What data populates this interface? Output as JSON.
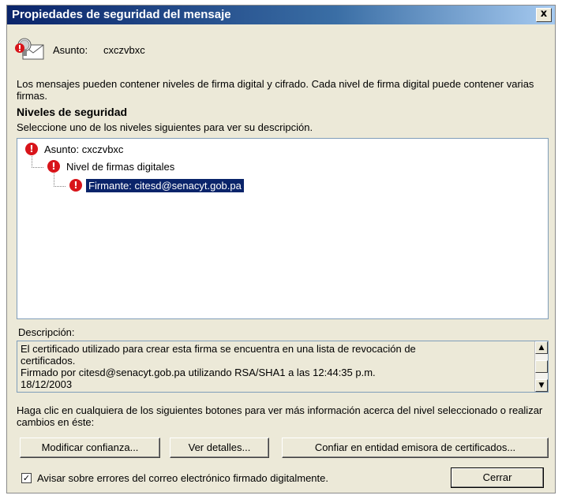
{
  "window": {
    "title": "Propiedades de seguridad del mensaje",
    "close_glyph": "x"
  },
  "subject": {
    "label": "Asunto:",
    "value": "cxczvbxc",
    "icon": "envelope-warning-icon"
  },
  "intro_text": "Los mensajes pueden contener niveles de firma digital y cifrado. Cada nivel de firma digital puede contener varias firmas.",
  "levels": {
    "heading": "Niveles de seguridad",
    "instruction": "Seleccione uno de los niveles siguientes para ver su descripción.",
    "items": [
      {
        "label": "Asunto: cxczvbxc",
        "icon": "error-icon"
      },
      {
        "label": "Nivel de firmas digitales",
        "icon": "error-icon"
      },
      {
        "label": "Firmante: citesd@senacyt.gob.pa",
        "icon": "error-icon",
        "selected": true
      }
    ]
  },
  "description": {
    "label": "Descripción:",
    "lines": [
      "El certificado utilizado para crear esta firma se encuentra en una lista de revocación de",
      "certificados.",
      "Firmado por citesd@senacyt.gob.pa utilizando RSA/SHA1 a las 12:44:35 p.m.",
      "18/12/2003"
    ]
  },
  "help_text": "Haga clic en cualquiera de los siguientes botones para ver más información acerca del nivel seleccionado o realizar cambios en éste:",
  "buttons": {
    "modify_trust": "Modificar confianza...",
    "view_details": "Ver detalles...",
    "trust_ca": "Confiar en entidad emisora de certificados...",
    "close": "Cerrar"
  },
  "checkbox": {
    "label": "Avisar sobre errores del correo electrónico firmado digitalmente.",
    "checked": true
  },
  "colors": {
    "titlebar": "#0a246a",
    "error": "#d8141a",
    "selection": "#0a246a",
    "dialog_bg": "#ece9d8"
  }
}
